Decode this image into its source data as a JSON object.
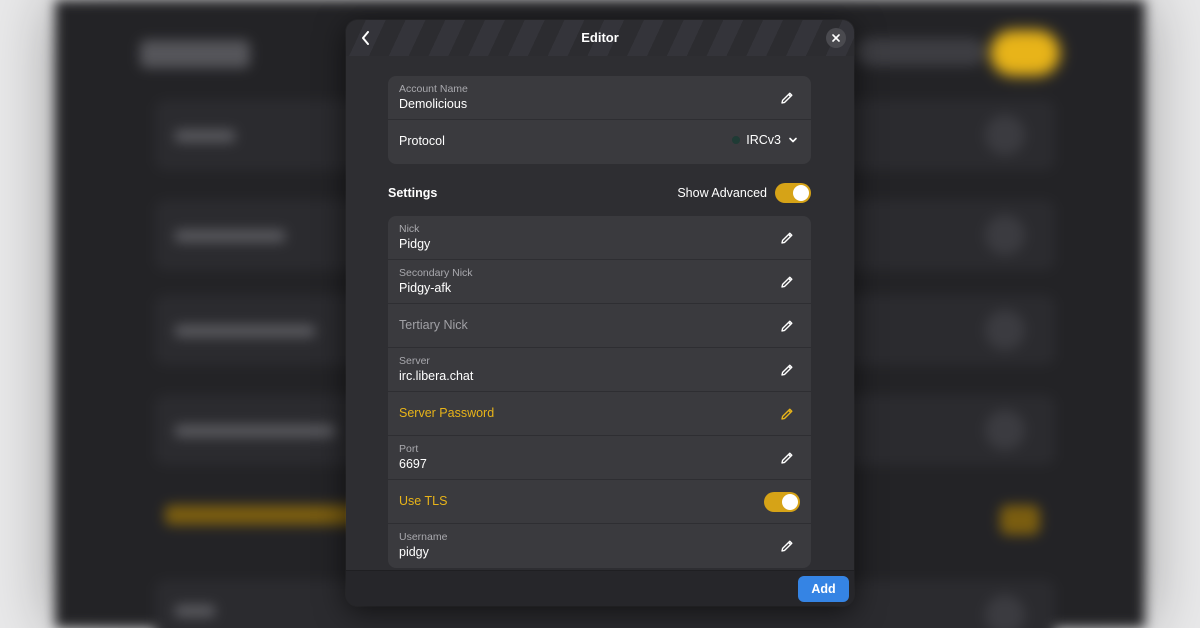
{
  "dialog": {
    "title": "Editor",
    "add_label": "Add"
  },
  "account": {
    "name_label": "Account Name",
    "name_value": "Demolicious",
    "protocol_label": "Protocol",
    "protocol_value": "IRCv3"
  },
  "settings": {
    "title": "Settings",
    "show_advanced_label": "Show Advanced",
    "show_advanced_on": true,
    "fields": [
      {
        "label": "Nick",
        "value": "Pidgy"
      },
      {
        "label": "Secondary Nick",
        "value": "Pidgy-afk"
      },
      {
        "placeholder": "Tertiary Nick"
      },
      {
        "label": "Server",
        "value": "irc.libera.chat"
      },
      {
        "warning_label": "Server Password"
      },
      {
        "label": "Port",
        "value": "6697"
      },
      {
        "toggle_label": "Use TLS",
        "toggle_on": true
      },
      {
        "label": "Username",
        "value": "pidgy"
      }
    ]
  },
  "colors": {
    "accent_yellow": "#d6a317",
    "warning_text": "#e8b419",
    "add_button": "#3584e4",
    "dialog_bg": "#2e2e32",
    "row_bg": "#3a3a3e"
  }
}
